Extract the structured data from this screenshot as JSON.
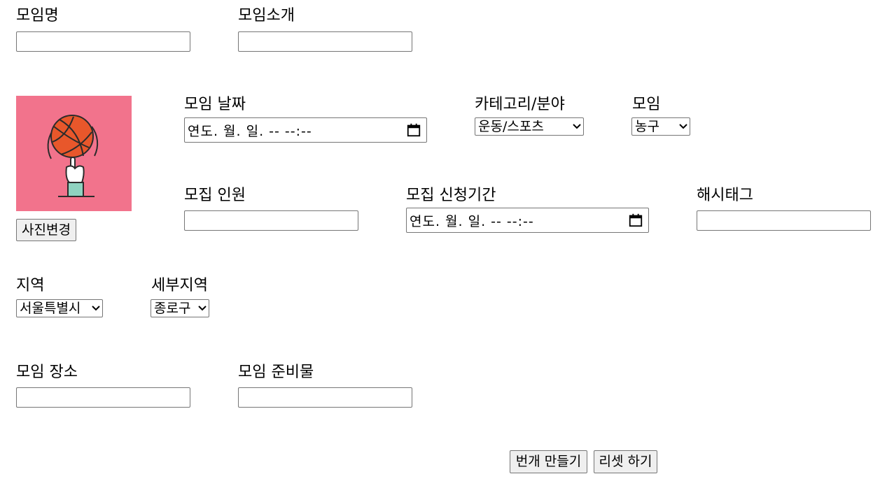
{
  "form": {
    "group_name_label": "모임명",
    "group_intro_label": "모임소개",
    "photo_change_button": "사진변경",
    "date_label": "모임 날짜",
    "date_placeholder": "연도. 월. 일. -- --:--",
    "category_label": "카테고리/분야",
    "category_value": "운동/스포츠",
    "group_type_label": "모임",
    "group_type_value": "농구",
    "recruit_count_label": "모집 인원",
    "apply_period_label": "모집 신청기간",
    "apply_period_placeholder": "연도. 월. 일. -- --:--",
    "hashtag_label": "해시태그",
    "region_label": "지역",
    "region_value": "서울특별시",
    "subregion_label": "세부지역",
    "subregion_value": "종로구",
    "place_label": "모임 장소",
    "supplies_label": "모임 준비물",
    "create_button": "번개 만들기",
    "reset_button": "리셋 하기"
  },
  "image": {
    "icon": "basketball-spin-icon",
    "background_color": "#f2738c"
  },
  "colors": {
    "input_border": "#767676",
    "button_bg": "#efefef",
    "ball": "#e8572b",
    "ball_dark": "#b23e1e"
  }
}
